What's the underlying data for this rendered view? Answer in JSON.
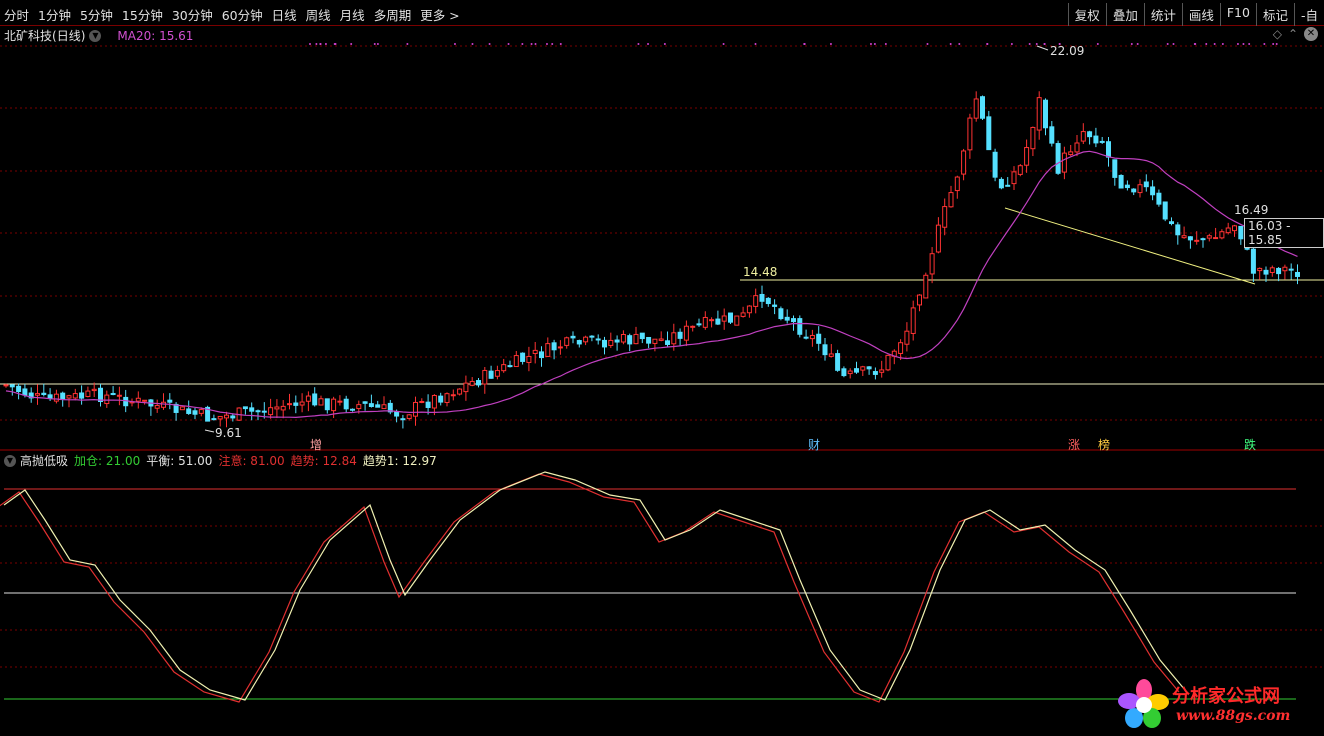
{
  "toolbar": {
    "periods": [
      "分时",
      "1分钟",
      "5分钟",
      "15分钟",
      "30分钟",
      "60分钟",
      "日线",
      "周线",
      "月线",
      "多周期",
      "更多 >"
    ],
    "actions": [
      "复权",
      "叠加",
      "统计",
      "画线",
      "F10",
      "标记",
      "-自"
    ]
  },
  "stock": {
    "name": "北矿科技",
    "period_tag": "(日线)",
    "ma_label": "MA20: 15.61"
  },
  "price_labels": {
    "high": "22.09",
    "low": "9.61",
    "mid_high": "14.48",
    "recent_high": "16.49",
    "crosshair": "16.03 - 15.85"
  },
  "event_markers": [
    "增",
    "财",
    "涨",
    "榜",
    "跌"
  ],
  "indicator": {
    "name": "高抛低吸",
    "values": [
      {
        "label": "加仓: 21.00",
        "color": "#33cc33"
      },
      {
        "label": "平衡: 51.00",
        "color": "#e0e0e0"
      },
      {
        "label": "注意: 81.00",
        "color": "#e03030"
      },
      {
        "label": "趋势: 12.84",
        "color": "#e03030"
      },
      {
        "label": "趋势1: 12.97",
        "color": "#f0f0c0"
      }
    ]
  },
  "watermark": {
    "title": "分析家公式网",
    "url": "www.88gs.com"
  },
  "colors": {
    "up": "#ff3333",
    "down": "#55e0ff",
    "ma": "#c040c0",
    "grid": "#7a0000",
    "trend": "#e03030",
    "trend1": "#f0f0b0",
    "level_green": "#33cc33",
    "level_white": "#e0e0e0",
    "level_red": "#e03030"
  }
}
